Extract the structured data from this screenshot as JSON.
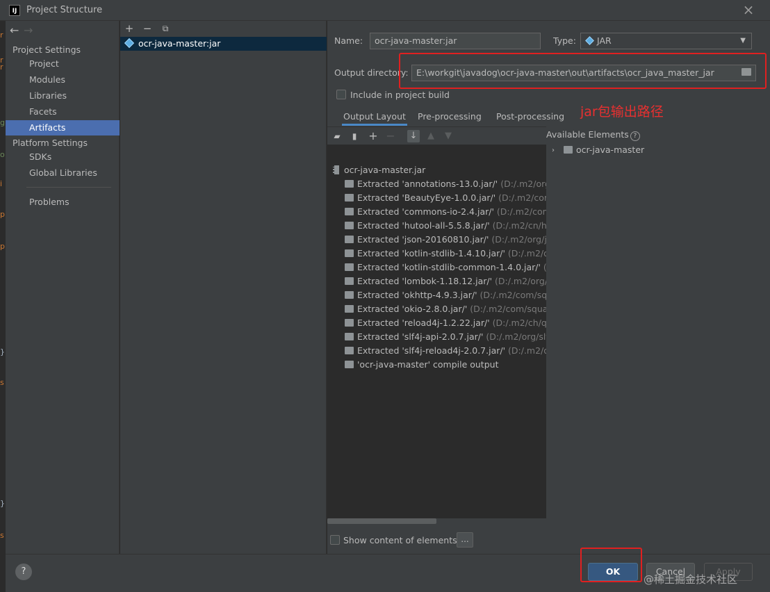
{
  "window": {
    "title": "Project Structure",
    "app_logo": "IJ"
  },
  "nav": {
    "project_settings": "Project Settings",
    "platform_settings": "Platform Settings",
    "items": [
      {
        "label": "Project",
        "selected": false
      },
      {
        "label": "Modules",
        "selected": false
      },
      {
        "label": "Libraries",
        "selected": false
      },
      {
        "label": "Facets",
        "selected": false
      },
      {
        "label": "Artifacts",
        "selected": true
      },
      {
        "label": "SDKs",
        "selected": false
      },
      {
        "label": "Global Libraries",
        "selected": false
      },
      {
        "label": "Problems",
        "selected": false
      }
    ]
  },
  "artifacts_list": {
    "items": [
      "ocr-java-master:jar"
    ]
  },
  "detail": {
    "name_label": "Name:",
    "name_value": "ocr-java-master:jar",
    "type_label": "Type:",
    "type_value": "JAR",
    "output_dir_label": "Output directory:",
    "output_dir_value": "E:\\workgit\\javadog\\ocr-java-master\\out\\artifacts\\ocr_java_master_jar",
    "include_build_label": "Include in project build",
    "tabs": [
      "Output Layout",
      "Pre-processing",
      "Post-processing"
    ],
    "available_label": "Available Elements",
    "available_items": [
      "ocr-java-master"
    ],
    "show_content_label": "Show content of elements",
    "more_label": "..."
  },
  "tree": {
    "root": "ocr-java-master.jar",
    "items": [
      {
        "label": "Extracted 'annotations-13.0.jar/'",
        "path": "(D:/.m2/org/je"
      },
      {
        "label": "Extracted 'BeautyEye-1.0.0.jar/'",
        "path": "(D:/.m2/com/bu"
      },
      {
        "label": "Extracted 'commons-io-2.4.jar/'",
        "path": "(D:/.m2/comm"
      },
      {
        "label": "Extracted 'hutool-all-5.5.8.jar/'",
        "path": "(D:/.m2/cn/huto"
      },
      {
        "label": "Extracted 'json-20160810.jar/'",
        "path": "(D:/.m2/org/jsor"
      },
      {
        "label": "Extracted 'kotlin-stdlib-1.4.10.jar/'",
        "path": "(D:/.m2/org/"
      },
      {
        "label": "Extracted 'kotlin-stdlib-common-1.4.0.jar/'",
        "path": "(D:/."
      },
      {
        "label": "Extracted 'lombok-1.18.12.jar/'",
        "path": "(D:/.m2/org/pre"
      },
      {
        "label": "Extracted 'okhttp-4.9.3.jar/'",
        "path": "(D:/.m2/com/squar"
      },
      {
        "label": "Extracted 'okio-2.8.0.jar/'",
        "path": "(D:/.m2/com/squareu"
      },
      {
        "label": "Extracted 'reload4j-1.2.22.jar/'",
        "path": "(D:/.m2/ch/qos/"
      },
      {
        "label": "Extracted 'slf4j-api-2.0.7.jar/'",
        "path": "(D:/.m2/org/slf4j/"
      },
      {
        "label": "Extracted 'slf4j-reload4j-2.0.7.jar/'",
        "path": "(D:/.m2/org/"
      },
      {
        "label": "'ocr-java-master' compile output",
        "path": ""
      }
    ]
  },
  "buttons": {
    "ok": "OK",
    "cancel": "Cancel",
    "apply": "Apply",
    "help": "?"
  },
  "annotation": {
    "text": "jar包输出路径",
    "color": "#e83030"
  },
  "watermark": "@稀土掘金技术社区",
  "colors": {
    "selection": "#4b6eaf",
    "default_button": "#365880",
    "tab_underline": "#4a88c7"
  }
}
